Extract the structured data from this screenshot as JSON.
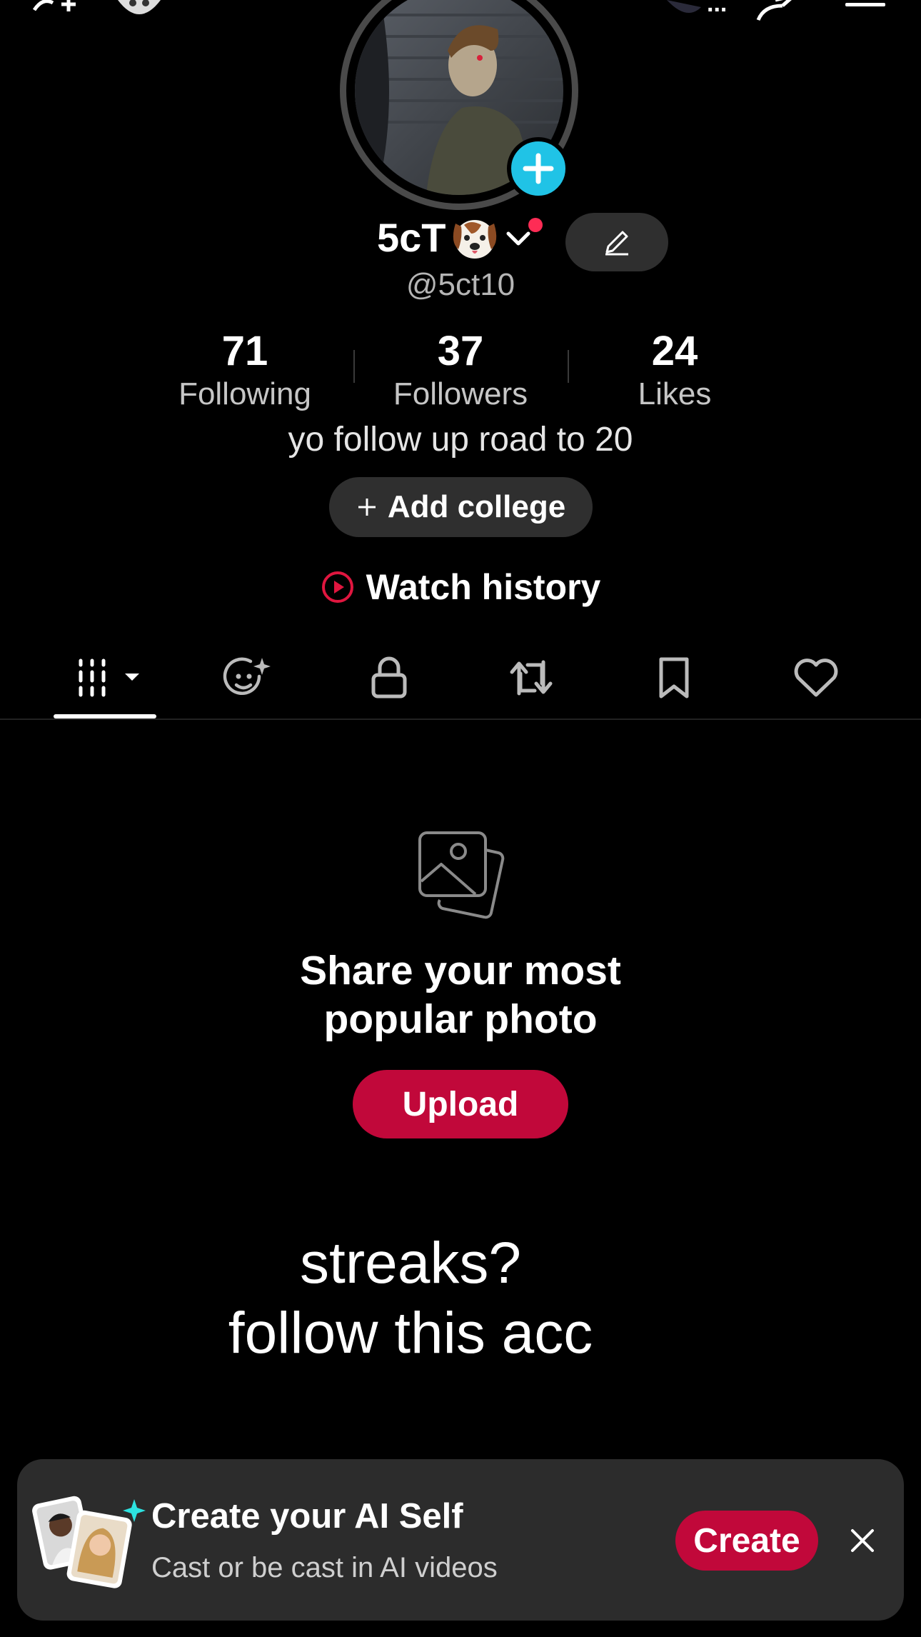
{
  "profile": {
    "display_name": "5cT",
    "username": "@5ct10",
    "bio": "yo follow up road to 20"
  },
  "stats": [
    {
      "value": "71",
      "label": "Following"
    },
    {
      "value": "37",
      "label": "Followers"
    },
    {
      "value": "24",
      "label": "Likes"
    }
  ],
  "actions": {
    "add_college_label": "Add college",
    "add_college_icon": "plus-icon",
    "watch_history_label": "Watch history",
    "watch_history_icon": "play-circle-icon"
  },
  "tabs": [
    {
      "icon": "grid-icon",
      "active": true
    },
    {
      "icon": "ai-face-icon"
    },
    {
      "icon": "lock-icon"
    },
    {
      "icon": "repost-icon"
    },
    {
      "icon": "bookmark-icon"
    },
    {
      "icon": "heart-icon"
    }
  ],
  "empty_state": {
    "title_line1": "Share your most",
    "title_line2": "popular photo",
    "button_label": "Upload"
  },
  "overlay": {
    "line1": "streaks?",
    "line2": "follow this acc"
  },
  "banner": {
    "title": "Create your AI Self",
    "subtitle": "Cast or be cast in AI videos",
    "button_label": "Create"
  },
  "topbar": {
    "more_label": "..."
  },
  "colors": {
    "accent_red": "#c1083a",
    "notification_red": "#fe2c55",
    "add_blue": "#20c3e6",
    "surface": "#2f2f2f"
  }
}
